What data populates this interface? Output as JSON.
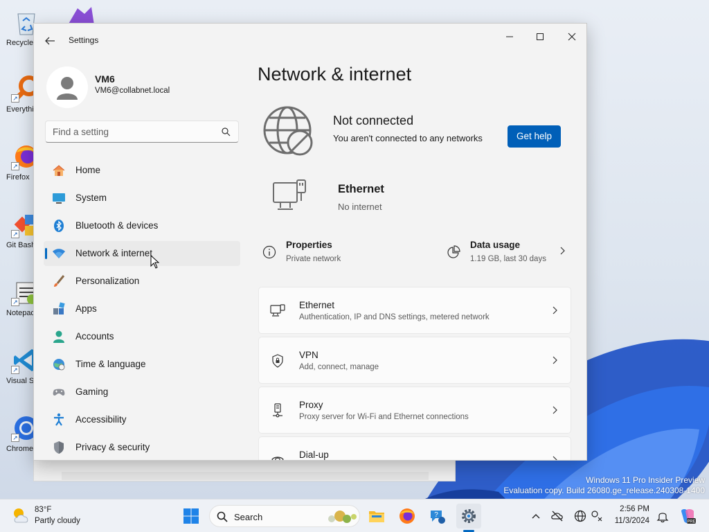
{
  "desktop": {
    "icons": [
      {
        "label": "Recycle Bin"
      },
      {
        "label": "Everything"
      },
      {
        "label": "Firefox"
      },
      {
        "label": "Git Bash"
      },
      {
        "label": "Notepad++"
      },
      {
        "label": "Visual Studio Code"
      },
      {
        "label": "Chrome"
      }
    ],
    "watermark_line1": "Windows 11 Pro Insider Preview",
    "watermark_line2": "Evaluation copy. Build 26080.ge_release.240308-1400"
  },
  "window": {
    "title": "Settings",
    "profile": {
      "name": "VM6",
      "email": "VM6@collabnet.local"
    },
    "search_placeholder": "Find a setting",
    "nav": [
      {
        "label": "Home",
        "icon": "home-icon"
      },
      {
        "label": "System",
        "icon": "system-icon"
      },
      {
        "label": "Bluetooth & devices",
        "icon": "bluetooth-icon"
      },
      {
        "label": "Network & internet",
        "icon": "wifi-icon",
        "active": true
      },
      {
        "label": "Personalization",
        "icon": "brush-icon"
      },
      {
        "label": "Apps",
        "icon": "apps-icon"
      },
      {
        "label": "Accounts",
        "icon": "accounts-icon"
      },
      {
        "label": "Time & language",
        "icon": "globe-clock-icon"
      },
      {
        "label": "Gaming",
        "icon": "gamepad-icon"
      },
      {
        "label": "Accessibility",
        "icon": "accessibility-icon"
      },
      {
        "label": "Privacy & security",
        "icon": "shield-icon"
      }
    ],
    "page_title": "Network & internet",
    "status": {
      "title": "Not connected",
      "description": "You aren't connected to any networks",
      "help_button": "Get help"
    },
    "ethernet": {
      "title": "Ethernet",
      "status": "No internet"
    },
    "quick": {
      "properties_title": "Properties",
      "properties_sub": "Private network",
      "data_title": "Data usage",
      "data_sub": "1.19 GB, last 30 days"
    },
    "cards": [
      {
        "title": "Ethernet",
        "sub": "Authentication, IP and DNS settings, metered network",
        "icon": "ethernet-icon"
      },
      {
        "title": "VPN",
        "sub": "Add, connect, manage",
        "icon": "vpn-shield-icon"
      },
      {
        "title": "Proxy",
        "sub": "Proxy server for Wi-Fi and Ethernet connections",
        "icon": "proxy-icon"
      },
      {
        "title": "Dial-up",
        "sub": "",
        "icon": "dialup-icon"
      }
    ]
  },
  "taskbar": {
    "weather": {
      "temp": "83°F",
      "desc": "Partly cloudy"
    },
    "search_label": "Search",
    "clock": {
      "time": "2:56 PM",
      "date": "11/3/2024"
    }
  },
  "colors": {
    "accent": "#005fb8",
    "indicator": "#0067c0"
  }
}
